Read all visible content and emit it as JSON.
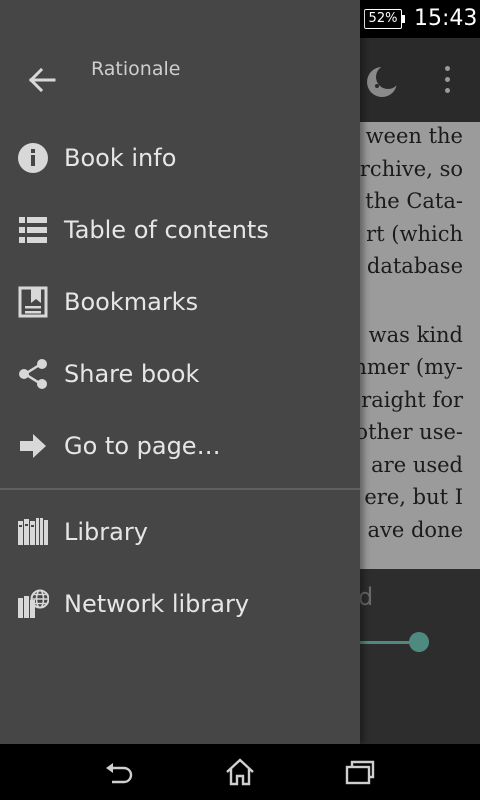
{
  "status_bar": {
    "battery_percent": "52%",
    "time": "15:43"
  },
  "drawer": {
    "title": "Rationale",
    "items": [
      {
        "label": "Book info",
        "icon": "info-icon"
      },
      {
        "label": "Table of contents",
        "icon": "list-icon"
      },
      {
        "label": "Bookmarks",
        "icon": "bookmark-icon"
      },
      {
        "label": "Share book",
        "icon": "share-icon"
      },
      {
        "label": "Go to page…",
        "icon": "arrow-right-icon"
      },
      {
        "label": "Library",
        "icon": "library-icon"
      },
      {
        "label": "Network library",
        "icon": "network-library-icon"
      }
    ]
  },
  "reader": {
    "lines": [
      "ween the",
      "archive, so",
      "the Cata-",
      "rt (which",
      "database",
      "was kind",
      "mmer (my-",
      "raight for",
      "other use-",
      "are used",
      "ere, but I",
      "ave done"
    ],
    "panel_partial_text": "d"
  },
  "colors": {
    "drawer_bg": "#464646",
    "accent": "#4f8a80",
    "status_bar_bg": "#000000"
  }
}
